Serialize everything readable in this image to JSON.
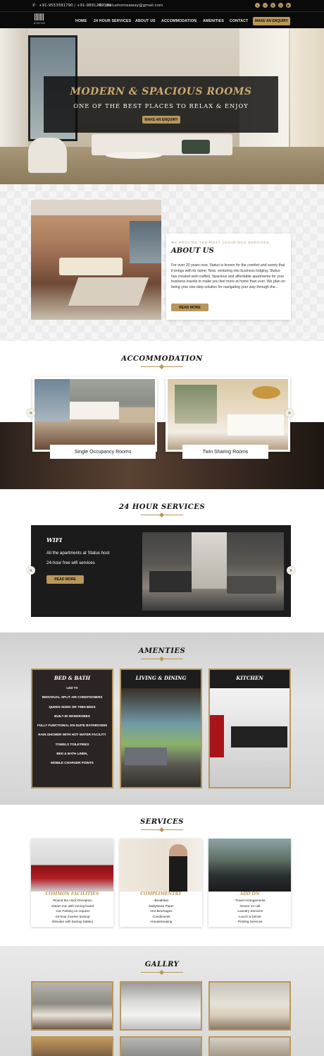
{
  "header": {
    "phone": "+91-9553581790 / +91-9891209020",
    "email": "statushomeaway@gmail.com",
    "logo_text": "STATUS",
    "nav": [
      "HOME",
      "24 HOUR SERVICES",
      "ABOUT US",
      "ACCOMMODATION",
      "AMENITIES",
      "CONTACT"
    ],
    "cta": "MAKE AN ENQUIRY",
    "social_icons": [
      "facebook-icon",
      "twitter-icon",
      "instagram-icon",
      "pinterest-icon",
      "youtube-icon"
    ]
  },
  "hero": {
    "title": "MODERN & SPACIOUS ROOMS",
    "subtitle": "ONE OF THE BEST PLACES TO RELAX & ENJOY",
    "button": "MAKE AN ENQUIRY"
  },
  "about": {
    "eyebrow": "WE PROVIDE THE MOST LUXURIOUS SERVICES.",
    "title": "ABOUT US",
    "body": "For over 20 years now, Status is known for the comfort and surety that it brings with its name. Now, venturing into business lodging, Status has created well-crafted, Spacious and affordable apartments for your business travels to make you feel more at home than ever. We plan on being your one-step solution for navigating your way through the...",
    "button": "READ MORE"
  },
  "accommodation": {
    "title": "ACCOMMODATION",
    "rooms": [
      "Single Occupancy Rooms",
      "Twin Sharing Rooms"
    ],
    "prev": "«",
    "next": "»"
  },
  "services24": {
    "title": "24 HOUR SERVICES",
    "slide_title": "WIFI",
    "line1": "All the apartments at Status host",
    "line2": "24-hour free wifi services",
    "button": "READ MORE",
    "prev": "«",
    "next": "»"
  },
  "amenities": {
    "title": "AMENTIES",
    "cards": [
      {
        "title": "BED & BATH",
        "items": [
          "LED TV",
          "INDIVISUAL SPLIT AIR CONDITIONERS",
          "QUEEN SIZED OR TWIN BEDS",
          "BUILT-IN WARDROBES",
          "FULLY FUNCTIONAL EN-SUITE BATHROOMS",
          "RAIN SHOWER WITH HOT WATER FACILITY",
          "TOWELS TOILETRIES",
          "BED & BATH LINEN,",
          "MOBILE CHARGER POINTS"
        ]
      },
      {
        "title": "LIVING & DINING"
      },
      {
        "title": "KITCHEN"
      }
    ]
  },
  "services": {
    "title": "SERVICES",
    "cards": [
      {
        "title": "COMMON FACILITIES",
        "items": [
          "-Round the clock Reception",
          "-Steam iron with ironing board",
          "-Car Parking on request",
          "-24-hour inverter backup",
          "-Elevator with backup battery"
        ]
      },
      {
        "title": "COMPLIMENTRY",
        "items": [
          "-Breakfast",
          "-DailyNews Paper",
          "-Hot Beverages",
          "-Condiments",
          "-HouseKeeping"
        ]
      },
      {
        "title": "ADD ON",
        "items": [
          "-Travel Arrangements",
          "-Doctor on-call",
          "-Laundry Services",
          "-Lunch & Dinner",
          "-Printing Services"
        ]
      }
    ]
  },
  "gallery": {
    "title": "GALLRY"
  },
  "colors": {
    "gold": "#b8975a",
    "dark": "#0a0a0a"
  }
}
